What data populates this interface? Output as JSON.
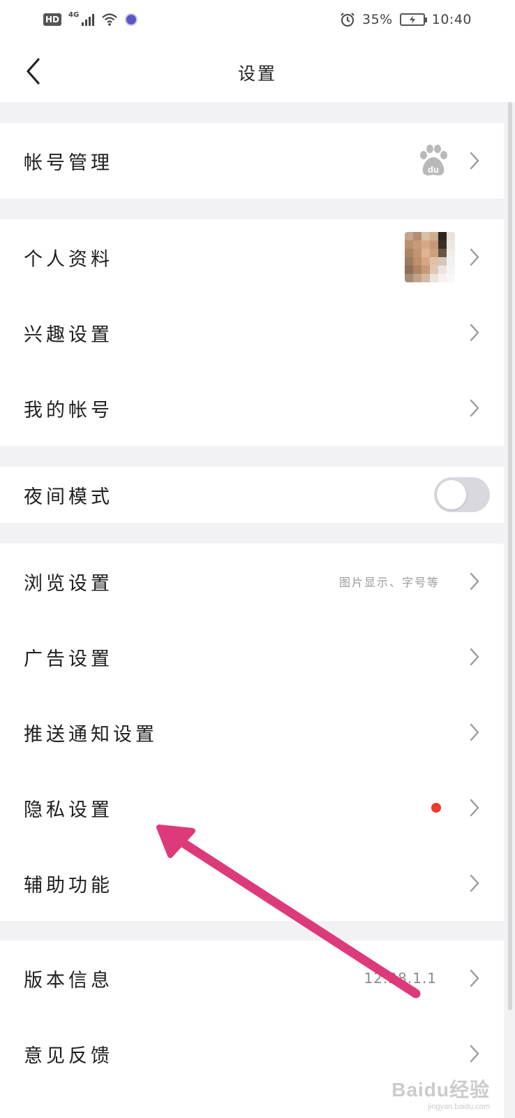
{
  "status_bar": {
    "hd": "HD",
    "network": "4G",
    "battery_percent": "35%",
    "time": "10:40"
  },
  "header": {
    "title": "设置"
  },
  "sections": {
    "account": {
      "label": "帐号管理"
    },
    "profile": {
      "label": "个人资料"
    },
    "interest": {
      "label": "兴趣设置"
    },
    "my_account": {
      "label": "我的帐号"
    },
    "night_mode": {
      "label": "夜间模式",
      "enabled": false
    },
    "browse": {
      "label": "浏览设置",
      "hint": "图片显示、字号等"
    },
    "ads": {
      "label": "广告设置"
    },
    "push": {
      "label": "推送通知设置"
    },
    "privacy": {
      "label": "隐私设置",
      "has_badge": true
    },
    "accessibility": {
      "label": "辅助功能"
    },
    "version": {
      "label": "版本信息",
      "value": "12.28.1.1"
    },
    "feedback": {
      "label": "意见反馈"
    }
  },
  "icons": {
    "back": "back-arrow-icon",
    "chevron": "chevron-right-icon",
    "account_logo": "baidu-paw-logo"
  },
  "colors": {
    "background": "#f2f2f4",
    "badge_red": "#f0392b",
    "toggle_off": "#d8d8de",
    "annotation_arrow": "#dd3a7c"
  },
  "watermark": {
    "main": "Baidu经验",
    "sub": "jingyan.baidu.com"
  }
}
